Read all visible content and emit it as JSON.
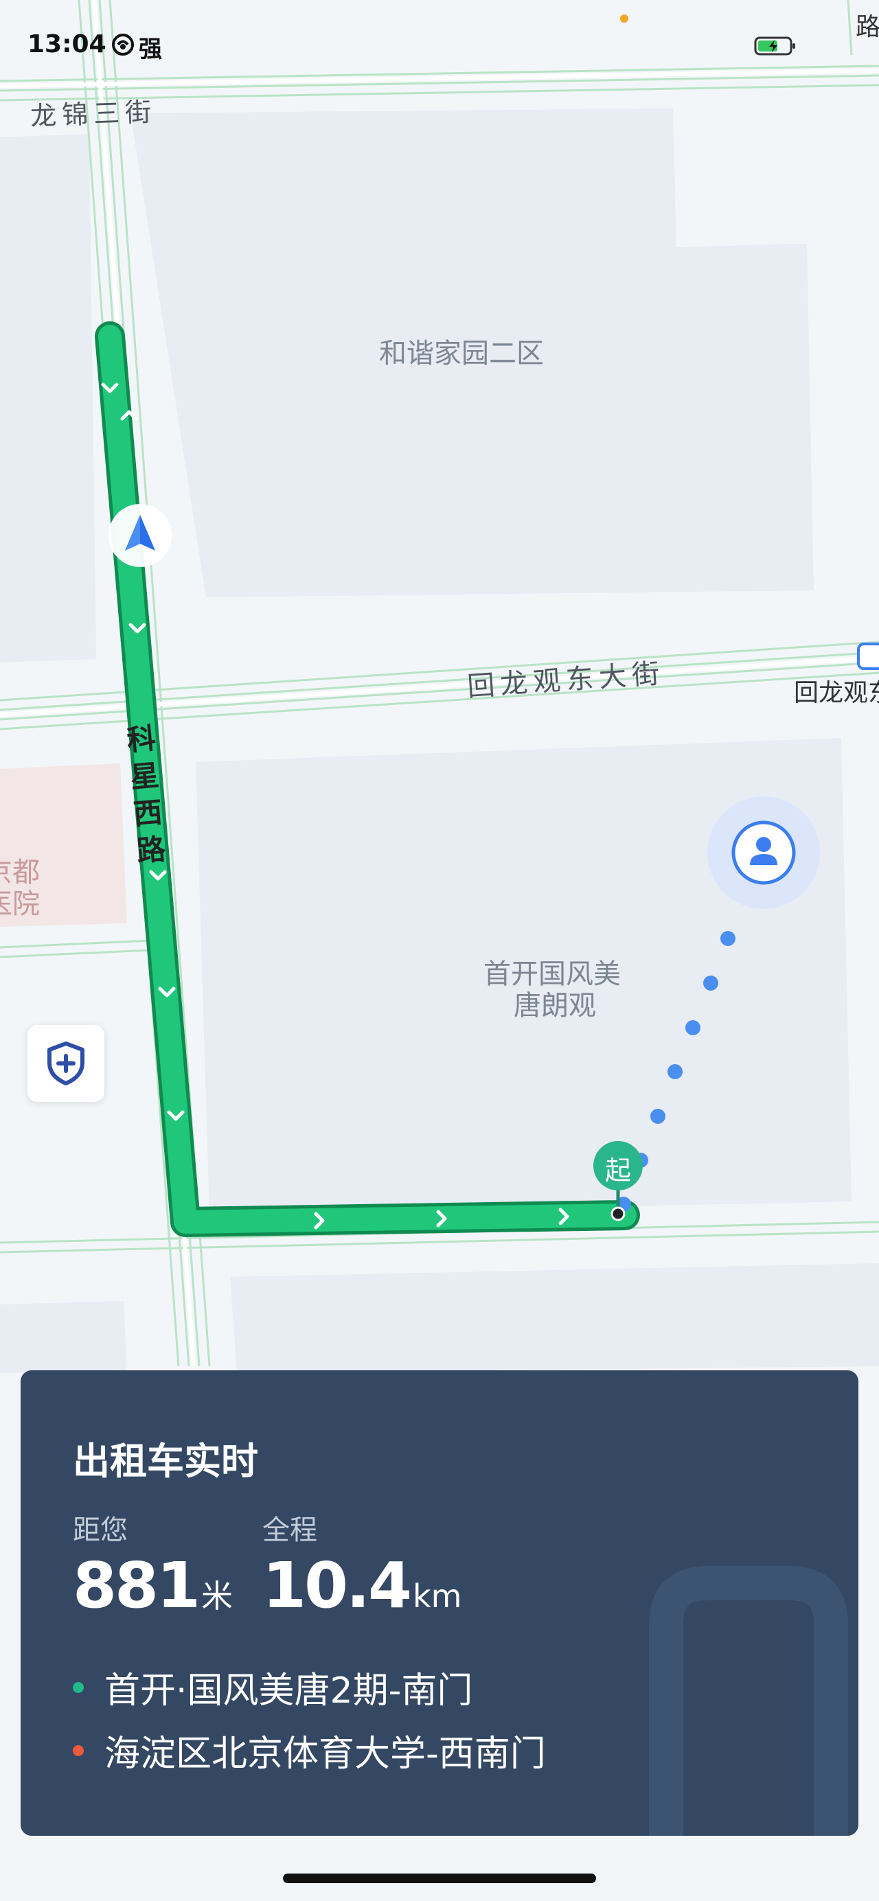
{
  "status_bar": {
    "time": "13:04",
    "carrier": "强"
  },
  "map": {
    "labels": {
      "longjin_street": "龙锦三街",
      "community": "和谐家园二区",
      "huilongguan_street": "回龙观东大街",
      "huilongguan_partial": "回龙观东",
      "kexing_road": "科星西路",
      "hospital_line1": "京都",
      "hospital_line2": "医院",
      "estate_line1": "首开国风美",
      "estate_line2": "唐朗观",
      "corner_partial": "路"
    },
    "start_marker": "起",
    "colors": {
      "route": "#20c77a",
      "route_border": "#0f8a50",
      "walking_dots": "#4a8ef0",
      "user_marker": "#3c7ef0"
    }
  },
  "card": {
    "title": "出租车实时",
    "distance_label": "距您",
    "distance_value": "881",
    "distance_unit": "米",
    "total_label": "全程",
    "total_value": "10.4",
    "total_unit": "km",
    "pickup": "首开·国风美唐2期-南门",
    "destination": "海淀区北京体育大学-西南门",
    "colors": {
      "background": "#344863",
      "pickup_dot": "#21b98a",
      "destination_dot": "#f05a3c"
    }
  }
}
